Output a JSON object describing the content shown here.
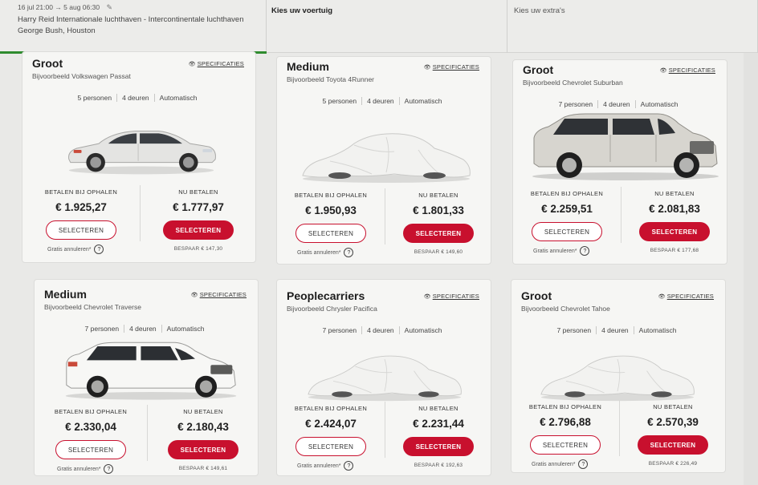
{
  "trip": {
    "dates": "16 jul 21:00 → 5 aug 06:30",
    "route_line1": "Harry Reid Internationale luchthaven - Intercontinentale luchthaven",
    "route_line2": "George Bush, Houston"
  },
  "steps": {
    "vehicle": "Kies uw voertuig",
    "extras": "Kies uw extra's"
  },
  "labels": {
    "pay_later": "BETALEN BIJ OPHALEN",
    "pay_now": "NU BETALEN",
    "select": "SELECTEREN",
    "free_cancel": "Gratis annuleren*",
    "specs": "SPECIFICATIES"
  },
  "colors": {
    "accent_red": "#c8102e",
    "progress_green": "#2e8b2e"
  },
  "cards": [
    {
      "category": "Groot",
      "example": "Bijvoorbeeld Volkswagen Passat",
      "persons": "5 personen",
      "doors": "4 deuren",
      "transmission": "Automatisch",
      "image": "sedan",
      "price_later": "€ 1.925,27",
      "price_now": "€ 1.777,97",
      "saving": "BESPAAR € 147,30"
    },
    {
      "category": "Medium",
      "example": "Bijvoorbeeld Toyota 4Runner",
      "persons": "5 personen",
      "doors": "4 deuren",
      "transmission": "Automatisch",
      "image": "covered-car",
      "price_later": "€ 1.950,93",
      "price_now": "€ 1.801,33",
      "saving": "BESPAAR € 149,60"
    },
    {
      "category": "Groot",
      "example": "Bijvoorbeeld Chevrolet Suburban",
      "persons": "7 personen",
      "doors": "4 deuren",
      "transmission": "Automatisch",
      "image": "suv-large",
      "price_later": "€ 2.259,51",
      "price_now": "€ 2.081,83",
      "saving": "BESPAAR € 177,68"
    },
    {
      "category": "Medium",
      "example": "Bijvoorbeeld Chevrolet Traverse",
      "persons": "7 personen",
      "doors": "4 deuren",
      "transmission": "Automatisch",
      "image": "suv-white",
      "price_later": "€ 2.330,04",
      "price_now": "€ 2.180,43",
      "saving": "BESPAAR € 149,61"
    },
    {
      "category": "Peoplecarriers",
      "example": "Bijvoorbeeld Chrysler Pacifica",
      "persons": "7 personen",
      "doors": "4 deuren",
      "transmission": "Automatisch",
      "image": "covered-car",
      "price_later": "€ 2.424,07",
      "price_now": "€ 2.231,44",
      "saving": "BESPAAR € 192,63"
    },
    {
      "category": "Groot",
      "example": "Bijvoorbeeld Chevrolet Tahoe",
      "persons": "7 personen",
      "doors": "4 deuren",
      "transmission": "Automatisch",
      "image": "covered-car",
      "price_later": "€ 2.796,88",
      "price_now": "€ 2.570,39",
      "saving": "BESPAAR € 226,49"
    }
  ]
}
